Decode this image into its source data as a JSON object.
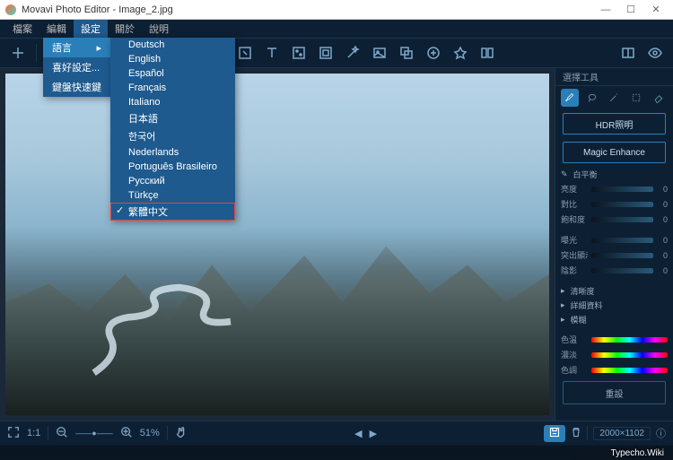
{
  "window": {
    "title": "Movavi Photo Editor - Image_2.jpg"
  },
  "menu": {
    "items": [
      "檔案",
      "編輯",
      "設定",
      "關於",
      "說明"
    ],
    "active_index": 2
  },
  "settings_dropdown": {
    "items": [
      {
        "label": "語言",
        "has_submenu": true,
        "highlight": true
      },
      {
        "label": "喜好設定...",
        "has_submenu": false
      },
      {
        "label": "鍵盤快速鍵",
        "has_submenu": false
      }
    ]
  },
  "language_submenu": {
    "items": [
      "Deutsch",
      "English",
      "Español",
      "Français",
      "Italiano",
      "日本語",
      "한국어",
      "Nederlands",
      "Português Brasileiro",
      "Русский",
      "Türkçe",
      "繁體中文"
    ],
    "selected_index": 11
  },
  "sidebar": {
    "header": "選擇工具",
    "btn_hdr": "HDR照明",
    "btn_enhance": "Magic Enhance",
    "wb_label": "白平衡",
    "sliders": [
      {
        "label": "亮度",
        "value": "0"
      },
      {
        "label": "對比",
        "value": "0"
      },
      {
        "label": "飽和度",
        "value": "0"
      }
    ],
    "sliders2": [
      {
        "label": "曝光",
        "value": "0"
      },
      {
        "label": "突出顯示",
        "value": "0"
      },
      {
        "label": "陰影",
        "value": "0"
      }
    ],
    "props": [
      "清晰度",
      "詳細資料",
      "模糊"
    ],
    "color_sliders": [
      "色溫",
      "濃淡",
      "色調"
    ],
    "reset": "重設"
  },
  "status": {
    "zoom_ratio": "1:1",
    "zoom_percent": "51%",
    "dimensions": "2000×1102"
  },
  "watermark": "Typecho.Wiki"
}
